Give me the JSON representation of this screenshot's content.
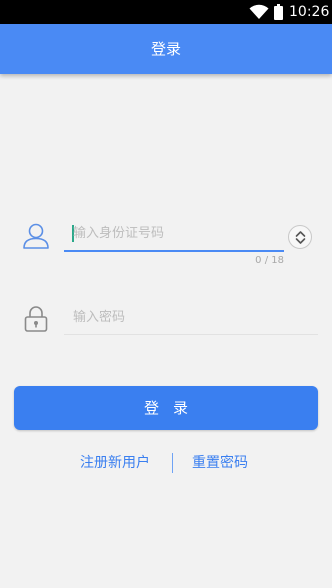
{
  "status_bar": {
    "time": "10:26",
    "wifi_icon": "wifi-icon",
    "battery_icon": "battery-icon"
  },
  "app_bar": {
    "title": "登录",
    "background": "#4a8af4"
  },
  "form": {
    "id_field": {
      "placeholder": "输入身份证号码",
      "value": "",
      "counter": "0 / 18",
      "icon": "user-icon"
    },
    "password_field": {
      "placeholder": "输入密码",
      "value": "",
      "icon": "lock-icon"
    },
    "input_type_toggle_icon": "chevron-up-down-icon"
  },
  "login_button": {
    "label": "登录",
    "color": "#3a7ff0"
  },
  "links": {
    "register": "注册新用户",
    "reset_password": "重置密码"
  }
}
